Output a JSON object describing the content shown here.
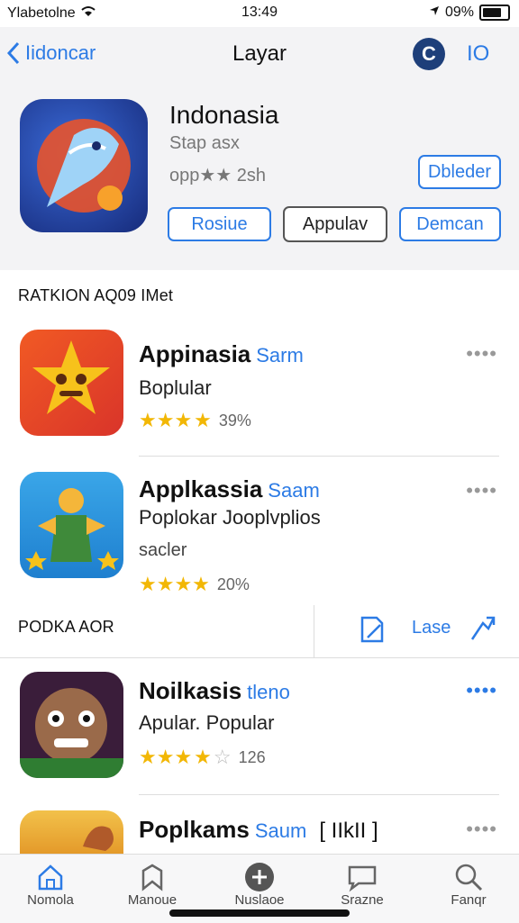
{
  "status": {
    "carrier": "Ylabetolne",
    "time": "13:49",
    "battery": "09%"
  },
  "nav": {
    "back_label": "Iidoncar",
    "title": "Layar",
    "action1": "C",
    "action2": "IO"
  },
  "hero": {
    "name": "Indonasia",
    "subtitle": "Stap asx",
    "rating_text": "opp★★ 2sh",
    "side_button": "Dbleder",
    "buttons": [
      "Rosiue",
      "Appulav",
      "Demcan"
    ]
  },
  "section1": {
    "title": "RATKION AQ09 IMet"
  },
  "apps": [
    {
      "name": "Appinasia",
      "tag": "Sarm",
      "lines": [
        "Boplular"
      ],
      "rating_text": "39%"
    },
    {
      "name": "Applkassia",
      "tag": "Saam",
      "lines": [
        "Poplokar Jooplvplios",
        "sacler"
      ],
      "rating_text": "20%"
    }
  ],
  "section2": {
    "title": "PODKA AOR",
    "action_label": "Lase"
  },
  "apps2": [
    {
      "name": "Noilkasis",
      "tag": "tleno",
      "lines": [
        "Apular. Popular"
      ],
      "rating_text": "126"
    },
    {
      "name": "Poplkams",
      "tag": "Saum",
      "extra": "[ IIkII ]"
    }
  ],
  "more_icon": "••••",
  "tabs": [
    {
      "label": "Nomola",
      "icon": "home-icon"
    },
    {
      "label": "Manoue",
      "icon": "bookmark-icon"
    },
    {
      "label": "Nuslaoe",
      "icon": "plus-icon"
    },
    {
      "label": "Srazne",
      "icon": "chat-icon"
    },
    {
      "label": "Fanqr",
      "icon": "search-icon"
    }
  ],
  "colors": {
    "accent": "#2c7be5",
    "star": "#f2b705",
    "hero_bg": "#f3f3f5"
  }
}
